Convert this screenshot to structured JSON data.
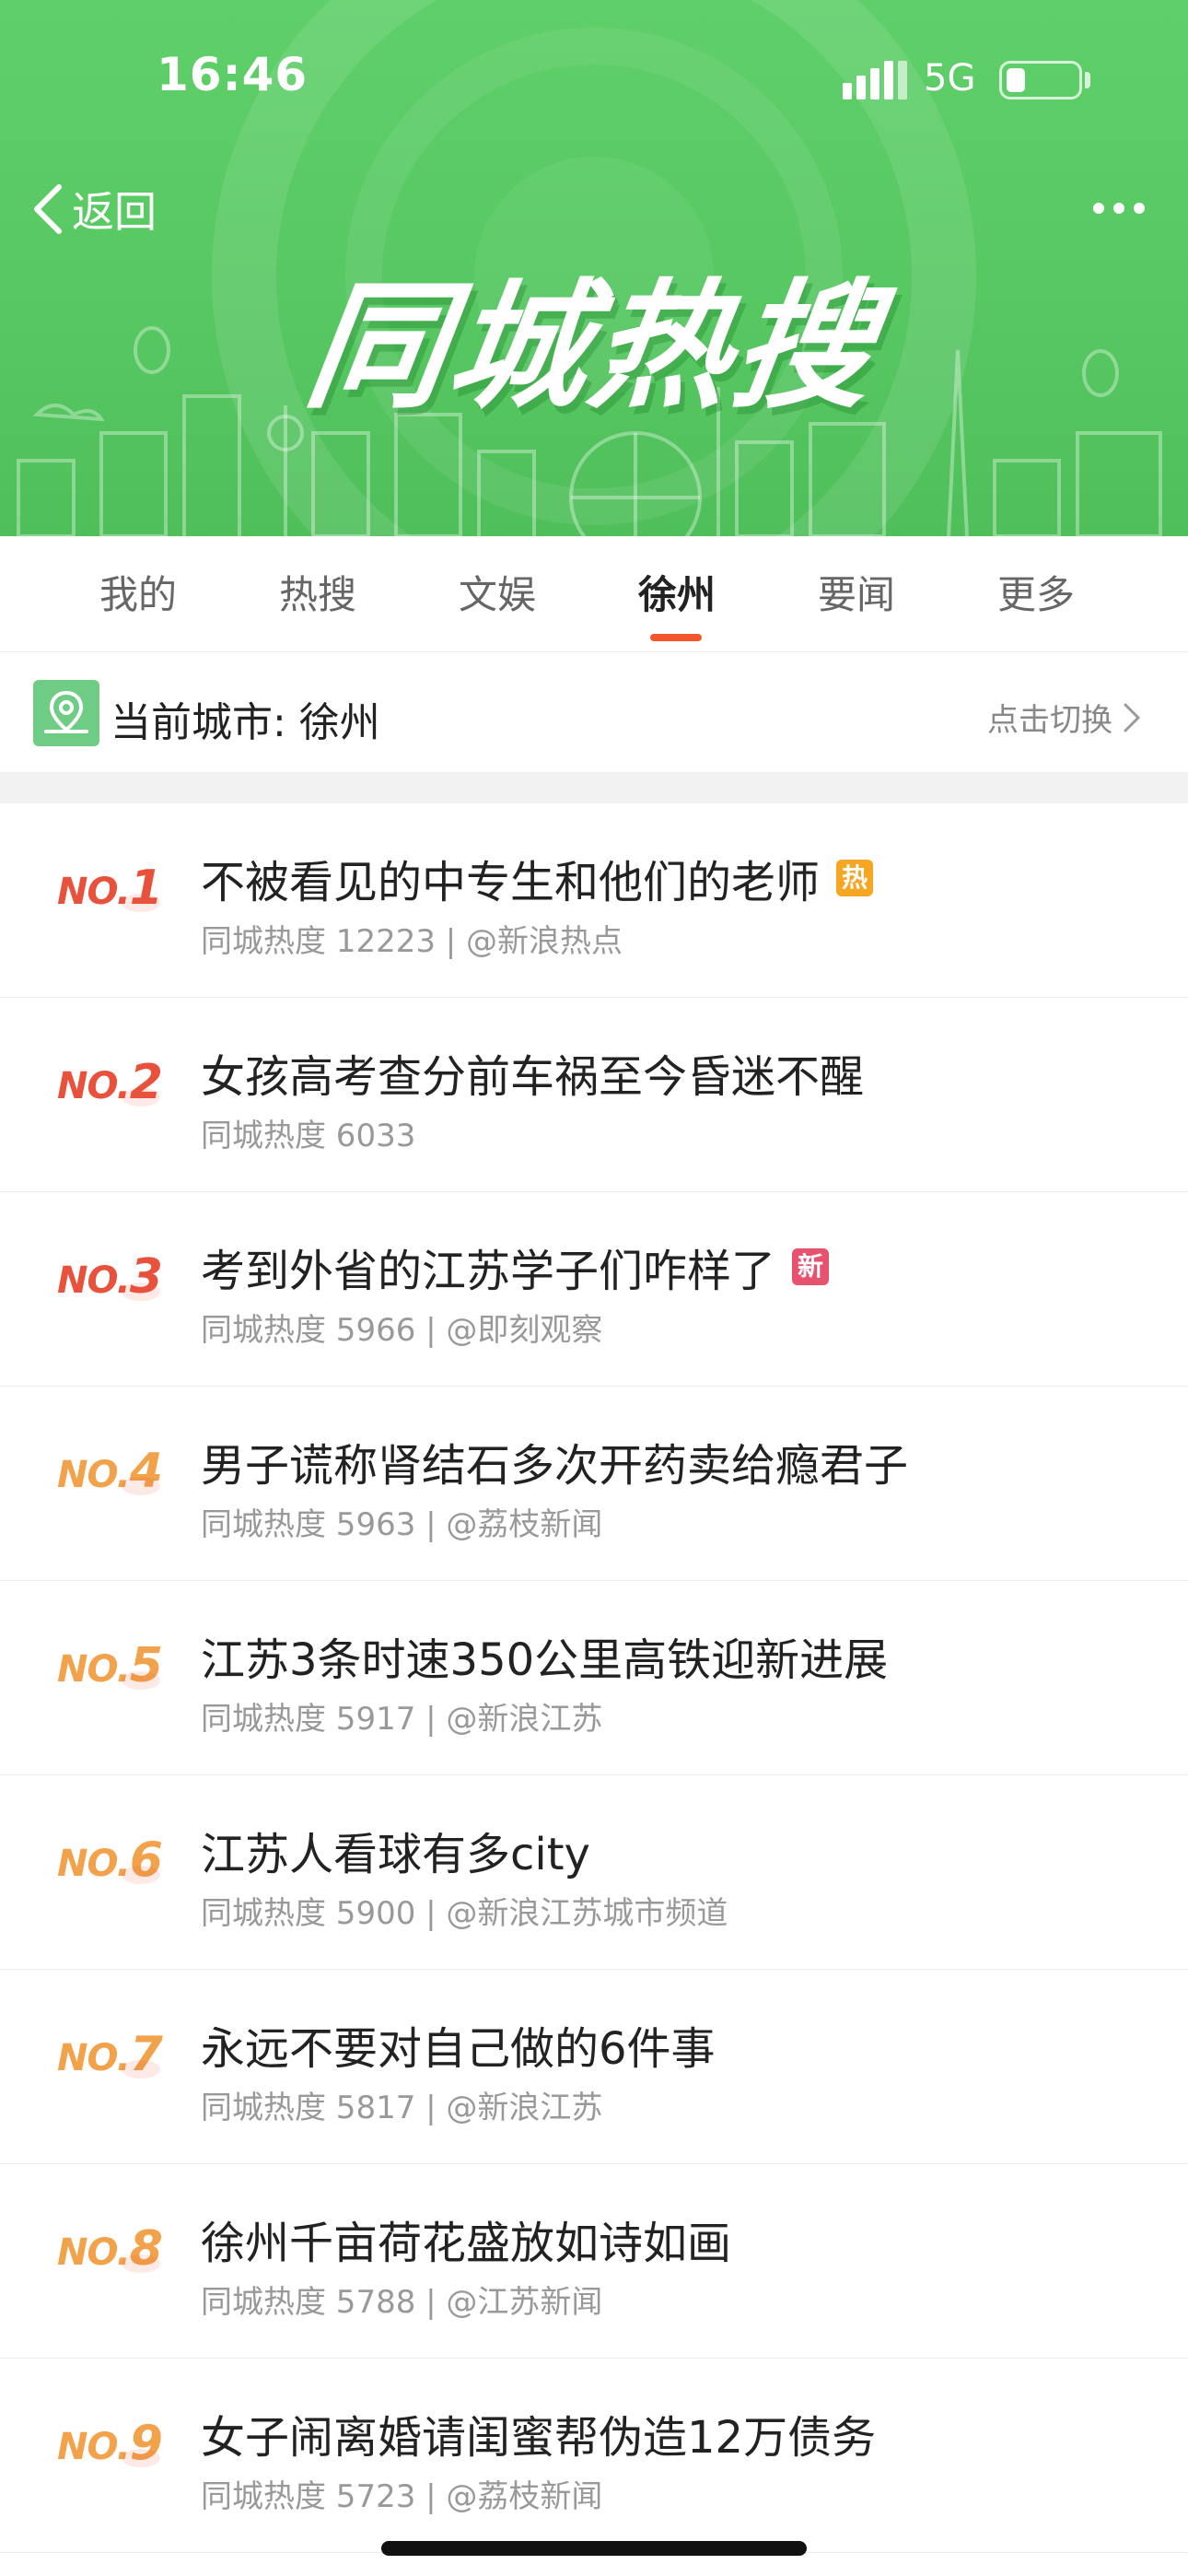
{
  "status_bar": {
    "time": "16:46",
    "network": "5G"
  },
  "header": {
    "back_label": "返回",
    "banner_title": "同城热搜",
    "colors": {
      "banner_green": "#56c761"
    }
  },
  "tabs": [
    {
      "label": "我的",
      "active": false
    },
    {
      "label": "热搜",
      "active": false
    },
    {
      "label": "文娱",
      "active": false
    },
    {
      "label": "徐州",
      "active": true
    },
    {
      "label": "要闻",
      "active": false
    },
    {
      "label": "更多",
      "active": false
    }
  ],
  "city": {
    "label": "当前城市: 徐州",
    "switch_label": "点击切换"
  },
  "items": [
    {
      "rank_prefix": "NO.",
      "rank": "1",
      "title": "不被看见的中专生和他们的老师",
      "meta": "同城热度 12223 | @新浪热点",
      "badge": "热",
      "badge_type": "hot",
      "rank_color": "#e8523d"
    },
    {
      "rank_prefix": "NO.",
      "rank": "2",
      "title": "女孩高考查分前车祸至今昏迷不醒",
      "meta": "同城热度 6033",
      "badge": "",
      "badge_type": "",
      "rank_color": "#e8523d"
    },
    {
      "rank_prefix": "NO.",
      "rank": "3",
      "title": "考到外省的江苏学子们咋样了",
      "meta": "同城热度 5966 | @即刻观察",
      "badge": "新",
      "badge_type": "new",
      "rank_color": "#e8523d"
    },
    {
      "rank_prefix": "NO.",
      "rank": "4",
      "title": "男子谎称肾结石多次开药卖给瘾君子",
      "meta": "同城热度 5963 | @荔枝新闻",
      "badge": "",
      "badge_type": "",
      "rank_color": "#f2a24a"
    },
    {
      "rank_prefix": "NO.",
      "rank": "5",
      "title": "江苏3条时速350公里高铁迎新进展",
      "meta": "同城热度 5917 | @新浪江苏",
      "badge": "",
      "badge_type": "",
      "rank_color": "#f2a24a"
    },
    {
      "rank_prefix": "NO.",
      "rank": "6",
      "title": "江苏人看球有多city",
      "meta": "同城热度 5900 | @新浪江苏城市频道",
      "badge": "",
      "badge_type": "",
      "rank_color": "#f2a24a"
    },
    {
      "rank_prefix": "NO.",
      "rank": "7",
      "title": "永远不要对自己做的6件事",
      "meta": "同城热度 5817 | @新浪江苏",
      "badge": "",
      "badge_type": "",
      "rank_color": "#f2a24a"
    },
    {
      "rank_prefix": "NO.",
      "rank": "8",
      "title": "徐州千亩荷花盛放如诗如画",
      "meta": "同城热度 5788 | @江苏新闻",
      "badge": "",
      "badge_type": "",
      "rank_color": "#f2a24a"
    },
    {
      "rank_prefix": "NO.",
      "rank": "9",
      "title": "女子闹离婚请闺蜜帮伪造12万债务",
      "meta": "同城热度 5723 | @荔枝新闻",
      "badge": "",
      "badge_type": "",
      "rank_color": "#f2a24a"
    }
  ]
}
